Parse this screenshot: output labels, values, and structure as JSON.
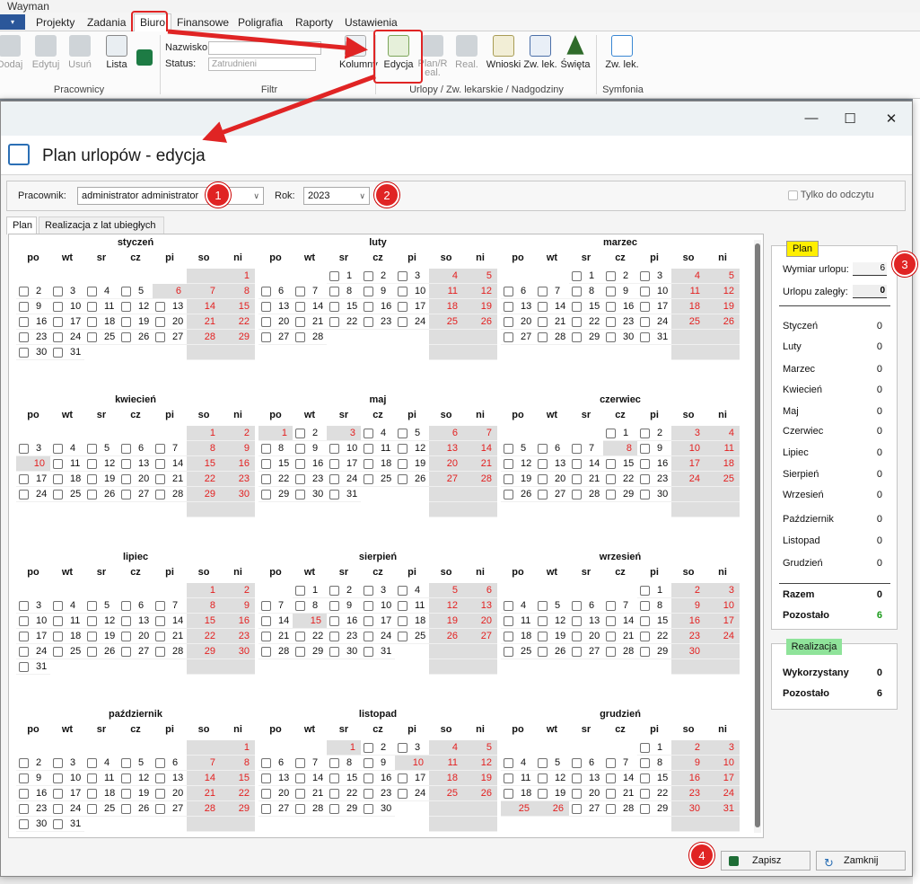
{
  "app": {
    "title": "Wayman"
  },
  "menu": {
    "app_btn": "▾",
    "items": [
      "Projekty",
      "Zadania",
      "Biuro",
      "Finansowe",
      "Poligrafia",
      "Raporty",
      "Ustawienia"
    ]
  },
  "ribbon": {
    "pracownicy": {
      "dodaj": "Dodaj",
      "edytuj": "Edytuj",
      "usun": "Usuń",
      "lista": "Lista",
      "group": "Pracownicy"
    },
    "filtr": {
      "nazwisko_label": "Nazwisko:",
      "status_label": "Status:",
      "status_value": "Zatrudnieni",
      "kolumny": "Kolumny",
      "group": "Filtr"
    },
    "urlopy": {
      "edycja": "Edycja",
      "plan_real": "Plan/R\neal.",
      "real": "Real.",
      "wnioski": "Wnioski",
      "zw_lek": "Zw. lek.",
      "swieta": "Święta",
      "group": "Urlopy / Zw. lekarskie / Nadgodziny"
    },
    "symfonia": {
      "zw_lek": "Zw. lek.",
      "group": "Symfonia"
    }
  },
  "dialog": {
    "title": "Plan urlopów - edycja",
    "controls": {
      "minimize": "—",
      "maximize": "☐",
      "close": "✕"
    },
    "toolbar": {
      "pracownik_label": "Pracownik:",
      "pracownik_value": "administrator administrator",
      "rok_label": "Rok:",
      "rok_value": "2023",
      "readonly_label": "Tylko do odczytu"
    },
    "tabs": [
      "Plan",
      "Realizacja z lat ubiegłych"
    ],
    "day_headers": [
      "po",
      "wt",
      "sr",
      "cz",
      "pi",
      "so",
      "ni"
    ],
    "months": [
      {
        "name": "styczeń",
        "start": 6,
        "days": 31,
        "highlight": [
          6
        ]
      },
      {
        "name": "luty",
        "start": 2,
        "days": 28,
        "highlight": []
      },
      {
        "name": "marzec",
        "start": 2,
        "days": 31,
        "highlight": []
      },
      {
        "name": "kwiecień",
        "start": 5,
        "days": 30,
        "highlight": [
          10
        ]
      },
      {
        "name": "maj",
        "start": 0,
        "days": 31,
        "highlight": [
          1,
          3
        ]
      },
      {
        "name": "czerwiec",
        "start": 3,
        "days": 30,
        "highlight": [
          8
        ]
      },
      {
        "name": "lipiec",
        "start": 5,
        "days": 31,
        "highlight": []
      },
      {
        "name": "sierpień",
        "start": 1,
        "days": 31,
        "highlight": [
          15
        ]
      },
      {
        "name": "wrzesień",
        "start": 4,
        "days": 30,
        "highlight": []
      },
      {
        "name": "październik",
        "start": 6,
        "days": 31,
        "highlight": []
      },
      {
        "name": "listopad",
        "start": 2,
        "days": 30,
        "highlight": [
          1,
          10
        ]
      },
      {
        "name": "grudzień",
        "start": 4,
        "days": 31,
        "highlight": [
          25,
          26
        ]
      }
    ],
    "plan": {
      "tag": "Plan",
      "wymiar_label": "Wymiar urlopu:",
      "wymiar_value": "6",
      "zalegly_label": "Urlopu zaległy:",
      "zalegly_value": "0",
      "months": [
        {
          "label": "Styczeń",
          "value": "0"
        },
        {
          "label": "Luty",
          "value": "0"
        },
        {
          "label": "Marzec",
          "value": "0"
        },
        {
          "label": "Kwiecień",
          "value": "0"
        },
        {
          "label": "Maj",
          "value": "0"
        },
        {
          "label": "Czerwiec",
          "value": "0"
        },
        {
          "label": "Lipiec",
          "value": "0"
        },
        {
          "label": "Sierpień",
          "value": "0"
        },
        {
          "label": "Wrzesień",
          "value": "0"
        },
        {
          "label": "Październik",
          "value": "0"
        },
        {
          "label": "Listopad",
          "value": "0"
        },
        {
          "label": "Grudzień",
          "value": "0"
        }
      ],
      "razem_label": "Razem",
      "razem_value": "0",
      "pozostalo_label": "Pozostało",
      "pozostalo_value": "6"
    },
    "realizacja": {
      "tag": "Realizacja",
      "wykorzystany_label": "Wykorzystany",
      "wykorzystany_value": "0",
      "pozostalo_label": "Pozostało",
      "pozostalo_value": "6"
    },
    "buttons": {
      "zapisz": "Zapisz",
      "zamknij": "Zamknij"
    }
  },
  "badges": [
    "1",
    "2",
    "3",
    "4"
  ],
  "colors": {
    "weekend_text": "#e32020",
    "weekend_bg": "#dedede",
    "plan_tag": "#ffef00",
    "realizacja_tag": "#8fe39a",
    "annotation": "#e02424",
    "pozostalo": "#1a9a1a"
  }
}
